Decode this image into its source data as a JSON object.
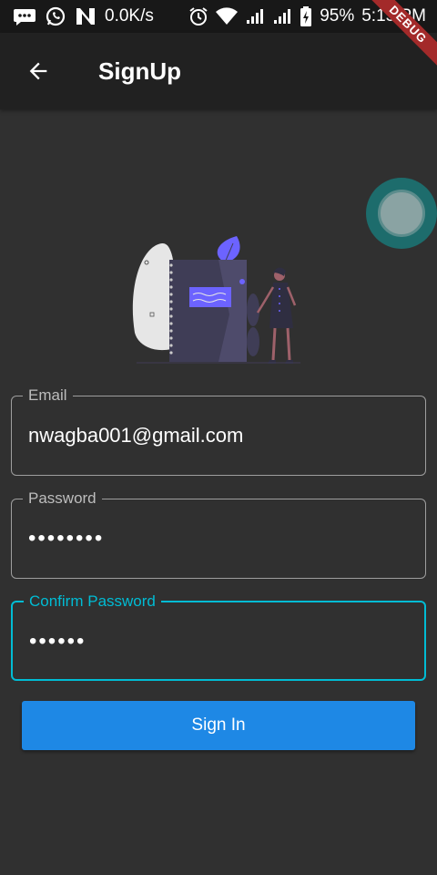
{
  "status_bar": {
    "network_speed": "0.0K/s",
    "battery_percent": "95%",
    "time": "5:15 PM",
    "icons": [
      "message-icon",
      "whatsapp-icon",
      "n-app-icon",
      "alarm-icon",
      "wifi-icon",
      "signal-icon",
      "signal-icon",
      "battery-charging-icon"
    ]
  },
  "debug_banner": "DEBUG",
  "app_bar": {
    "title": "SignUp",
    "back_icon": "arrow-back-icon"
  },
  "form": {
    "email": {
      "label": "Email",
      "value": "nwagba001@gmail.com"
    },
    "password": {
      "label": "Password",
      "value": "••••••••"
    },
    "confirm_password": {
      "label": "Confirm Password",
      "value": "••••••"
    }
  },
  "submit_button": {
    "label": "Sign In"
  },
  "colors": {
    "background": "#303030",
    "app_bar": "#212121",
    "status_bar": "#181818",
    "accent": "#00bcd4",
    "button": "#1e88e5",
    "illustration_accent": "#6c63ff"
  }
}
